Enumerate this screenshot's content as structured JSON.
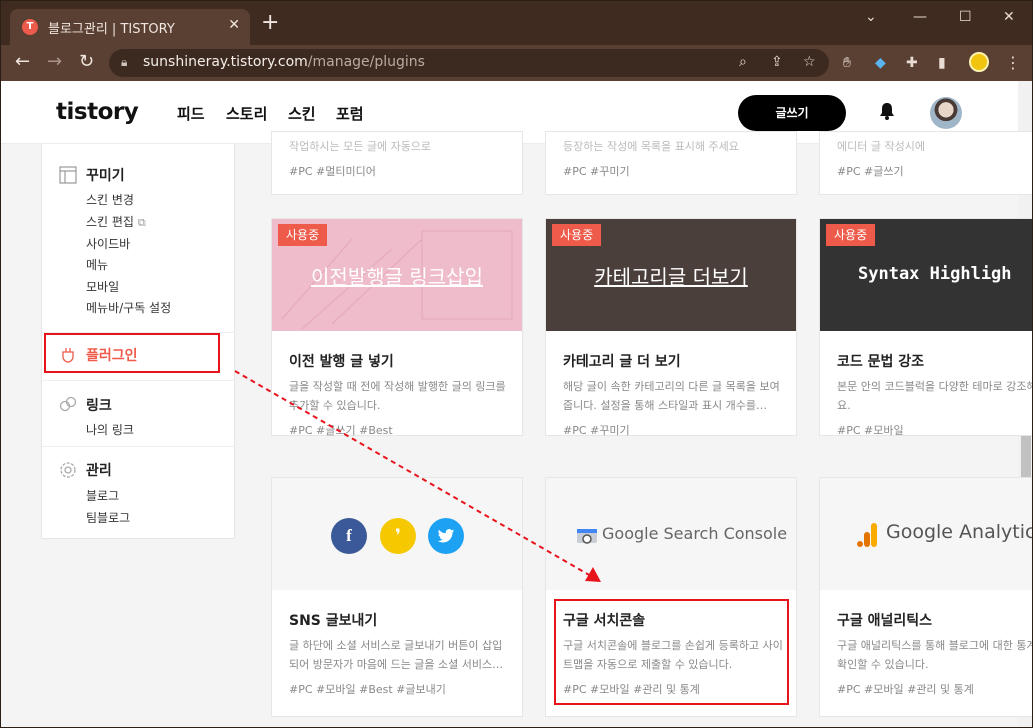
{
  "browser": {
    "tab_title": "블로그관리 | TISTORY",
    "tab_favicon": "T",
    "url_host": "sunshineray.tistory.com",
    "url_path": "/manage/plugins"
  },
  "header": {
    "logo": "tistory",
    "nav": [
      "피드",
      "스토리",
      "스킨",
      "포럼"
    ],
    "write_label": "글쓰기"
  },
  "sidebar": {
    "decorate": {
      "title": "꾸미기",
      "items": [
        "스킨 변경",
        "스킨 편집",
        "사이드바",
        "메뉴",
        "모바일",
        "메뉴바/구독 설정"
      ]
    },
    "plugin": {
      "title": "플러그인"
    },
    "link": {
      "title": "링크",
      "items": [
        "나의 링크"
      ]
    },
    "manage": {
      "title": "관리",
      "items": [
        "블로그",
        "팀블로그"
      ]
    }
  },
  "cards_top_partial": [
    {
      "desc": "작업하시는 모든 글에 자동으로",
      "tags": "#PC  #멀티미디어"
    },
    {
      "desc": "등장하는 작성에 목록을 표시해 주세요",
      "tags": "#PC  #꾸미기"
    },
    {
      "desc": "에디터 글 작성시에",
      "tags": "#PC  #글쓰기"
    }
  ],
  "cards_row2": [
    {
      "badge": "사용중",
      "thumb_text": "이전발행글 링크삽입",
      "title": "이전 발행 글 넣기",
      "desc": "글을 작성할 때 전에 작성해 발행한 글의 링크를 추가할 수 있습니다.",
      "tags": "#PC  #글쓰기  #Best"
    },
    {
      "badge": "사용중",
      "thumb_text": "카테고리글 더보기",
      "title": "카테고리 글 더 보기",
      "desc": "해당 글이 속한 카테고리의 다른 글 목록을 보여줍니다. 설정을 통해 스타일과 표시 개수를…",
      "tags": "#PC  #꾸미기"
    },
    {
      "badge": "사용중",
      "thumb_text": "Syntax Highligh",
      "title": "코드 문법 강조",
      "desc": "본문 안의 코드블럭을 다양한 테마로 강조해 세요.",
      "tags": "#PC  #모바일"
    }
  ],
  "cards_row3": [
    {
      "title": "SNS 글보내기",
      "desc": "글 하단에 소셜 서비스로 글보내기 버튼이 삽입되어 방문자가 마음에 드는 글을 소셜 서비스…",
      "tags": "#PC  #모바일  #Best  #글보내기"
    },
    {
      "thumb_text": "Google Search Console",
      "title": "구글 서치콘솔",
      "desc": "구글 서치콘솔에 블로그를 손쉽게 등록하고 사이트맵을 자동으로 제출할 수 있습니다.",
      "tags": "#PC  #모바일  #관리 및 통계"
    },
    {
      "thumb_text": "Google Analytic",
      "title": "구글 애널리틱스",
      "desc": "구글 애널리틱스를 통해 블로그에 대한 통계를 확인할 수 있습니다.",
      "tags": "#PC  #모바일  #관리 및 통계"
    }
  ],
  "colors": {
    "accent": "#ef5b4a",
    "highlight": "#e8141c",
    "pink_thumb": "#efbccb",
    "dark_thumb": "#4b3f3c",
    "code_thumb": "#333333"
  },
  "icons": [
    "facebook-icon",
    "kakaostory-icon",
    "twitter-icon",
    "google-search-console-icon",
    "google-analytics-icon"
  ]
}
